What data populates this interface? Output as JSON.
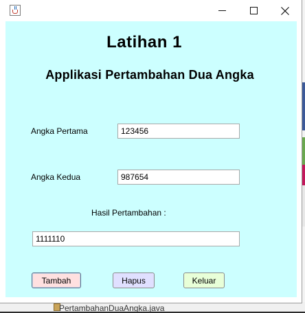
{
  "window": {
    "icon": "java-cup-icon",
    "controls": [
      "minimize-icon",
      "maximize-icon",
      "close-icon"
    ]
  },
  "header": {
    "title": "Latihan 1",
    "subtitle": "Applikasi Pertambahan Dua Angka"
  },
  "form": {
    "first_label": "Angka Pertama",
    "first_value": "123456",
    "second_label": "Angka Kedua",
    "second_value": "987654",
    "result_label": "Hasil Pertambahan :",
    "result_value": "1111110"
  },
  "buttons": {
    "add": "Tambah",
    "clear": "Hapus",
    "exit": "Keluar"
  },
  "background": {
    "file_name": "PertambahanDuaAngka.java"
  },
  "colors": {
    "content_bg": "#ccffff",
    "add_button": "#ffe0e0",
    "clear_button": "#e0e0ff",
    "exit_button": "#e8ffd8"
  }
}
